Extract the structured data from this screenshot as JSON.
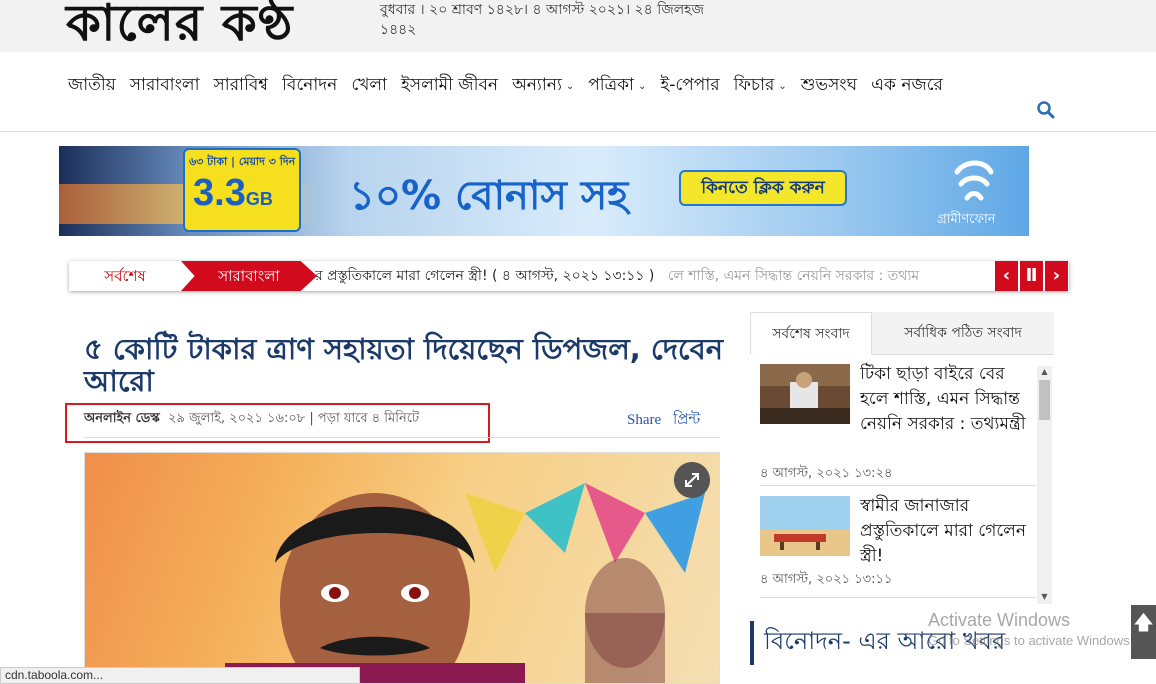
{
  "header": {
    "logo_text": "কালের কণ্ঠ",
    "date_line": "বুধবার । ২০ শ্রাবণ ১৪২৮। ৪ আগস্ট ২০২১। ২৪ জিলহজ ১৪৪২"
  },
  "nav": {
    "items": [
      {
        "label": "জাতীয়",
        "dropdown": false
      },
      {
        "label": "সারাবাংলা",
        "dropdown": false
      },
      {
        "label": "সারাবিশ্ব",
        "dropdown": false
      },
      {
        "label": "বিনোদন",
        "dropdown": false
      },
      {
        "label": "খেলা",
        "dropdown": false
      },
      {
        "label": "ইসলামী জীবন",
        "dropdown": false
      },
      {
        "label": "অন্যান্য",
        "dropdown": true
      },
      {
        "label": "পত্রিকা",
        "dropdown": true
      },
      {
        "label": "ই-পেপার",
        "dropdown": false
      },
      {
        "label": "ফিচার",
        "dropdown": true
      },
      {
        "label": "শুভসংঘ",
        "dropdown": false
      },
      {
        "label": "এক নজরে",
        "dropdown": false
      }
    ],
    "search_icon": "search-icon"
  },
  "banner": {
    "pack_top": "৬৩ টাকা | মেয়াদ ৩ দিন",
    "pack_gb": "3.3",
    "pack_unit": "GB",
    "bonus": "১০% বোনাস সহ",
    "cta": "কিনতে ক্লিক করুন",
    "brand": "গ্রামীণফোন"
  },
  "ticker": {
    "latest_label": "সর্বশেষ",
    "category": "সারাবাংলা",
    "text": "র প্রস্তুতিকালে মারা গেলেন স্ত্রী! ( ৪ আগস্ট, ২০২১ ১৩:১১ )",
    "text_faded": "লে শাস্তি, এমন সিদ্ধান্ত নেয়নি সরকার : তথ্যম"
  },
  "article": {
    "headline": "৫ কোটি টাকার ত্রাণ সহায়তা দিয়েছেন ডিপজল, দেবেন আরো",
    "author": "অনলাইন ডেস্ক",
    "date": "২৯ জুলাই, ২০২১ ১৬:০৮",
    "read_time": "পড়া যাবে ৪ মিনিটে",
    "share_label": "Share",
    "print_label": "প্রিন্ট"
  },
  "sidebar": {
    "tabs": [
      "সর্বশেষ সংবাদ",
      "সর্বাধিক পঠিত সংবাদ"
    ],
    "items": [
      {
        "title": "টিকা ছাড়া বাইরে বের হলে শাস্তি, এমন সিদ্ধান্ত নেয়নি সরকার : তথ্যমন্ত্রী",
        "time": "৪ আগস্ট, ২০২১ ১৩:২৪"
      },
      {
        "title": "স্বামীর জানাজার প্রস্তুতিকালে মারা গেলেন স্ত্রী!",
        "time": "৪ আগস্ট, ২০২১ ১৩:১১"
      }
    ],
    "section_title": "বিনোদন- এর আরো খবর"
  },
  "overlay": {
    "activate_title": "Activate Windows",
    "activate_sub": "Go to Settings to activate Windows."
  },
  "statusbar": {
    "text": "cdn.taboola.com..."
  },
  "colors": {
    "accent_red": "#d10a1e",
    "headline_blue": "#1b3a6a",
    "link_blue": "#2255aa"
  }
}
